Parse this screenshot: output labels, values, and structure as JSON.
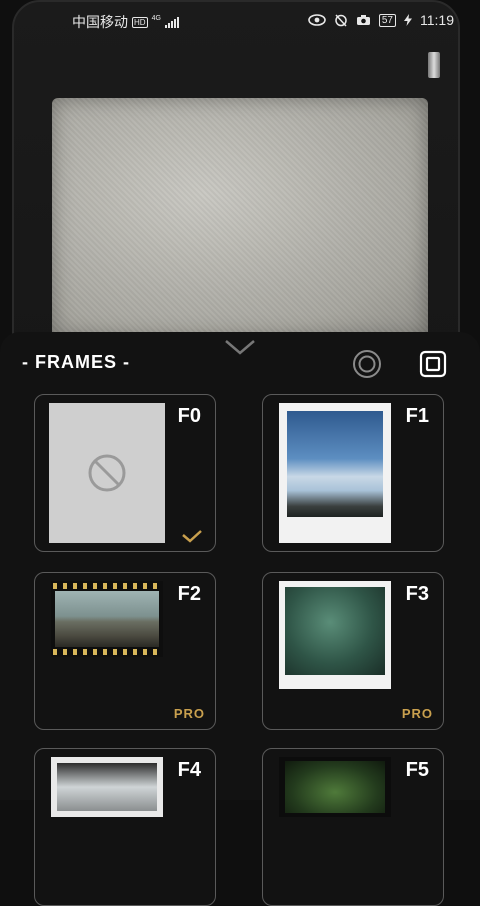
{
  "status_bar": {
    "carrier": "中国移动",
    "hd": "HD",
    "network": "4G",
    "battery": "57",
    "time": "11:19"
  },
  "sheet": {
    "title": "- FRAMES -"
  },
  "frames": [
    {
      "label": "F0",
      "badge": "",
      "selected": true
    },
    {
      "label": "F1",
      "badge": "",
      "selected": false
    },
    {
      "label": "F2",
      "badge": "PRO",
      "selected": false
    },
    {
      "label": "F3",
      "badge": "PRO",
      "selected": false
    },
    {
      "label": "F4",
      "badge": "",
      "selected": false
    },
    {
      "label": "F5",
      "badge": "",
      "selected": false
    }
  ],
  "icons": {
    "collapse": "chevron-down-icon",
    "mode_round": "circle-frame-icon",
    "mode_square": "square-frame-icon",
    "no_frame": "no-frame-icon",
    "selected": "checkmark-icon"
  },
  "colors": {
    "pro_badge": "#c9a04e",
    "check": "#c9a04e"
  }
}
